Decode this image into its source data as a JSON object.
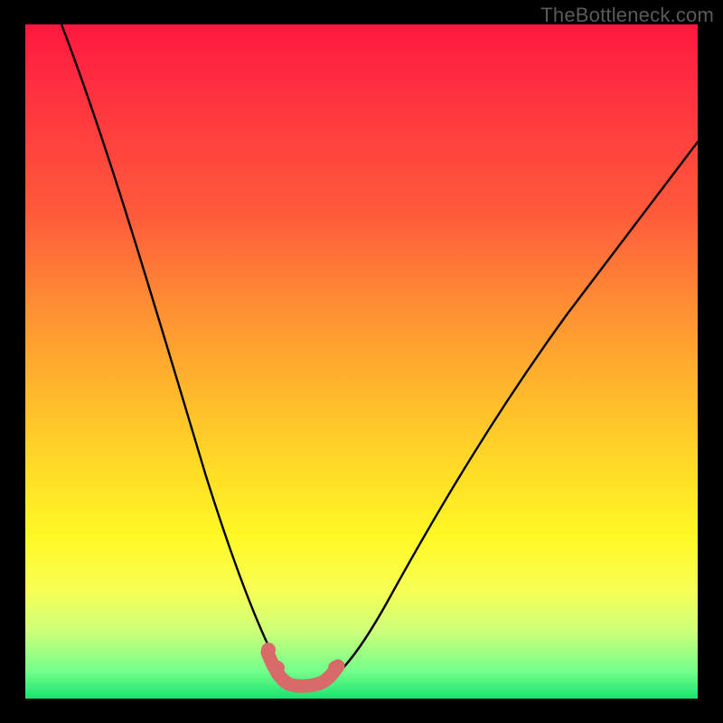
{
  "watermark": "TheBottleneck.com",
  "colors": {
    "background": "#000000",
    "curve": "#000000",
    "highlight": "#d86a6a",
    "gradient_stops": [
      "#ff173e",
      "#ff5a3b",
      "#ffd028",
      "#fff824",
      "#72ff8a",
      "#18e46e"
    ]
  },
  "chart_data": {
    "type": "line",
    "title": "",
    "xlabel": "",
    "ylabel": "",
    "xlim": [
      0,
      100
    ],
    "ylim": [
      0,
      100
    ],
    "series": [
      {
        "name": "bottleneck-curve",
        "x": [
          5,
          10,
          15,
          20,
          25,
          30,
          34,
          37,
          39,
          41,
          43,
          45,
          50,
          55,
          60,
          70,
          80,
          90,
          100
        ],
        "y": [
          100,
          80,
          63,
          48,
          34,
          22,
          12,
          6,
          3,
          2,
          2,
          3,
          6,
          12,
          20,
          36,
          50,
          62,
          72
        ]
      }
    ],
    "highlight_region": {
      "name": "optimal-range",
      "x": [
        36,
        45
      ],
      "y_floor": 2,
      "dots_x": [
        36.2,
        37.5,
        44.5
      ],
      "dots_y": [
        6.0,
        4.2,
        4.2
      ]
    }
  }
}
